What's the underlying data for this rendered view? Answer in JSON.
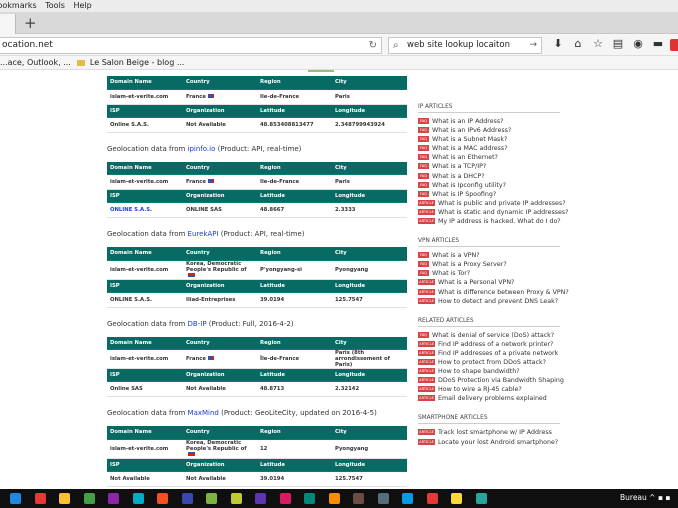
{
  "browser": {
    "menu": [
      "Bookmarks",
      "Tools",
      "Help"
    ],
    "url": "ocation.net",
    "search_value": "web site lookup locaiton",
    "bookmarks": [
      "...ace, Outlook, ...",
      "Le Salon Beige - blog ..."
    ]
  },
  "geo_tables": [
    {
      "title_prefix": "",
      "source": "",
      "title_suffix": "",
      "header1": [
        "Domain Name",
        "Country",
        "Region",
        "City"
      ],
      "row1": [
        "islam-et-verite.com",
        "France",
        "Ile-de-France",
        "Paris"
      ],
      "header2": [
        "ISP",
        "Organization",
        "Latitude",
        "Longitude"
      ],
      "row2": [
        "Online S.A.S.",
        "Not Available",
        "48.853408813477",
        "2.348799943924"
      ]
    },
    {
      "title_prefix": "Geolocation data from ",
      "source": "ipinfo.io",
      "title_suffix": " (Product: API, real-time)",
      "header1": [
        "Domain Name",
        "Country",
        "Region",
        "City"
      ],
      "row1": [
        "islam-et-verite.com",
        "France",
        "Ile-de-France",
        "Paris"
      ],
      "header2": [
        "ISP",
        "Organization",
        "Latitude",
        "Longitude"
      ],
      "row2": [
        "ONLINE S.A.S.",
        "ONLINE SAS",
        "48.8667",
        "2.3333"
      ]
    },
    {
      "title_prefix": "Geolocation data from ",
      "source": "EurekAPI",
      "title_suffix": " (Product: API, real-time)",
      "header1": [
        "Domain Name",
        "Country",
        "Region",
        "City"
      ],
      "row1": [
        "islam-et-verite.com",
        "Korea, Democratic People's Republic of",
        "P'yongyang-si",
        "Pyongyang"
      ],
      "header2": [
        "ISP",
        "Organization",
        "Latitude",
        "Longitude"
      ],
      "row2": [
        "ONLINE S.A.S.",
        "Iliad-Entreprises",
        "39.0194",
        "125.7547"
      ]
    },
    {
      "title_prefix": "Geolocation data from ",
      "source": "DB-IP",
      "title_suffix": " (Product: Full, 2016-4-2)",
      "header1": [
        "Domain Name",
        "Country",
        "Region",
        "City"
      ],
      "row1": [
        "islam-et-verite.com",
        "France",
        "Île-de-France",
        "Paris (8th arrondissement of Paris)"
      ],
      "header2": [
        "ISP",
        "Organization",
        "Latitude",
        "Longitude"
      ],
      "row2": [
        "Online SAS",
        "Not Available",
        "48.8713",
        "2.32142"
      ]
    },
    {
      "title_prefix": "Geolocation data from ",
      "source": "MaxMind",
      "title_suffix": " (Product: GeoLiteCity, updated on 2016-4-5)",
      "header1": [
        "Domain Name",
        "Country",
        "Region",
        "City"
      ],
      "row1": [
        "islam-et-verite.com",
        "Korea, Democratic People's Republic of",
        "12",
        "Pyongyang"
      ],
      "header2": [
        "ISP",
        "Organization",
        "Latitude",
        "Longitude"
      ],
      "row2": [
        "Not Available",
        "Not Available",
        "39.0194",
        "125.7547"
      ]
    }
  ],
  "sidebar": {
    "ip_articles": {
      "heading": "IP ARTICLES",
      "items": [
        {
          "badge": "FAQ",
          "text": "What is an IP Address?"
        },
        {
          "badge": "FAQ",
          "text": "What is an IPv6 Address?"
        },
        {
          "badge": "FAQ",
          "text": "What is a Subnet Mask?"
        },
        {
          "badge": "FAQ",
          "text": "What is a MAC address?"
        },
        {
          "badge": "FAQ",
          "text": "What is an Ethernet?"
        },
        {
          "badge": "FAQ",
          "text": "What is a TCP/IP?"
        },
        {
          "badge": "FAQ",
          "text": "What is a DHCP?"
        },
        {
          "badge": "FAQ",
          "text": "What is Ipconfig utility?"
        },
        {
          "badge": "FAQ",
          "text": "What is IP Spoofing?"
        },
        {
          "badge": "ARTICLE",
          "text": "What is public and private IP addresses?"
        },
        {
          "badge": "ARTICLE",
          "text": "What is static and dynamic IP addresses?"
        },
        {
          "badge": "ARTICLE",
          "text": "My IP address is hacked. What do I do?"
        }
      ]
    },
    "vpn_articles": {
      "heading": "VPN ARTICLES",
      "items": [
        {
          "badge": "FAQ",
          "text": "What is a VPN?"
        },
        {
          "badge": "FAQ",
          "text": "What is a Proxy Server?"
        },
        {
          "badge": "FAQ",
          "text": "What is Tor?"
        },
        {
          "badge": "ARTICLE",
          "text": "What is a Personal VPN?"
        },
        {
          "badge": "ARTICLE",
          "text": "What is difference between Proxy & VPN?"
        },
        {
          "badge": "ARTICLE",
          "text": "How to detect and prevent DNS Leak?"
        }
      ]
    },
    "related_articles": {
      "heading": "RELATED ARTICLES",
      "items": [
        {
          "badge": "FAQ",
          "text": "What is denial of service (DoS) attack?"
        },
        {
          "badge": "ARTICLE",
          "text": "Find IP address of a network printer?"
        },
        {
          "badge": "ARTICLE",
          "text": "Find IP addresses of a private network"
        },
        {
          "badge": "ARTICLE",
          "text": "How to protect from DDoS attack?"
        },
        {
          "badge": "ARTICLE",
          "text": "How to shape bandwidth?"
        },
        {
          "badge": "ARTICLE",
          "text": "DDoS Protection via Bandwidth Shaping"
        },
        {
          "badge": "ARTICLE",
          "text": "How to wire a RJ-45 cable?"
        },
        {
          "badge": "ARTICLE",
          "text": "Email delivery problems explained"
        }
      ]
    },
    "smartphone_articles": {
      "heading": "SMARTPHONE ARTICLES",
      "items": [
        {
          "badge": "ARTICLE",
          "text": "Track lost smartphone w/ IP Address"
        },
        {
          "badge": "ARTICLE",
          "text": "Locate your lost Android smartphone?"
        }
      ]
    }
  },
  "taskbar": {
    "label": "Bureau",
    "icon_colors": [
      "#1e88e5",
      "#e53935",
      "#fbc02d",
      "#43a047",
      "#8e24aa",
      "#00acc1",
      "#f4511e",
      "#3949ab",
      "#7cb342",
      "#c0ca33",
      "#5e35b1",
      "#d81b60",
      "#00897b",
      "#fb8c00",
      "#6d4c41",
      "#546e7a",
      "#039be5",
      "#e53935",
      "#fdd835",
      "#26a69a"
    ]
  }
}
